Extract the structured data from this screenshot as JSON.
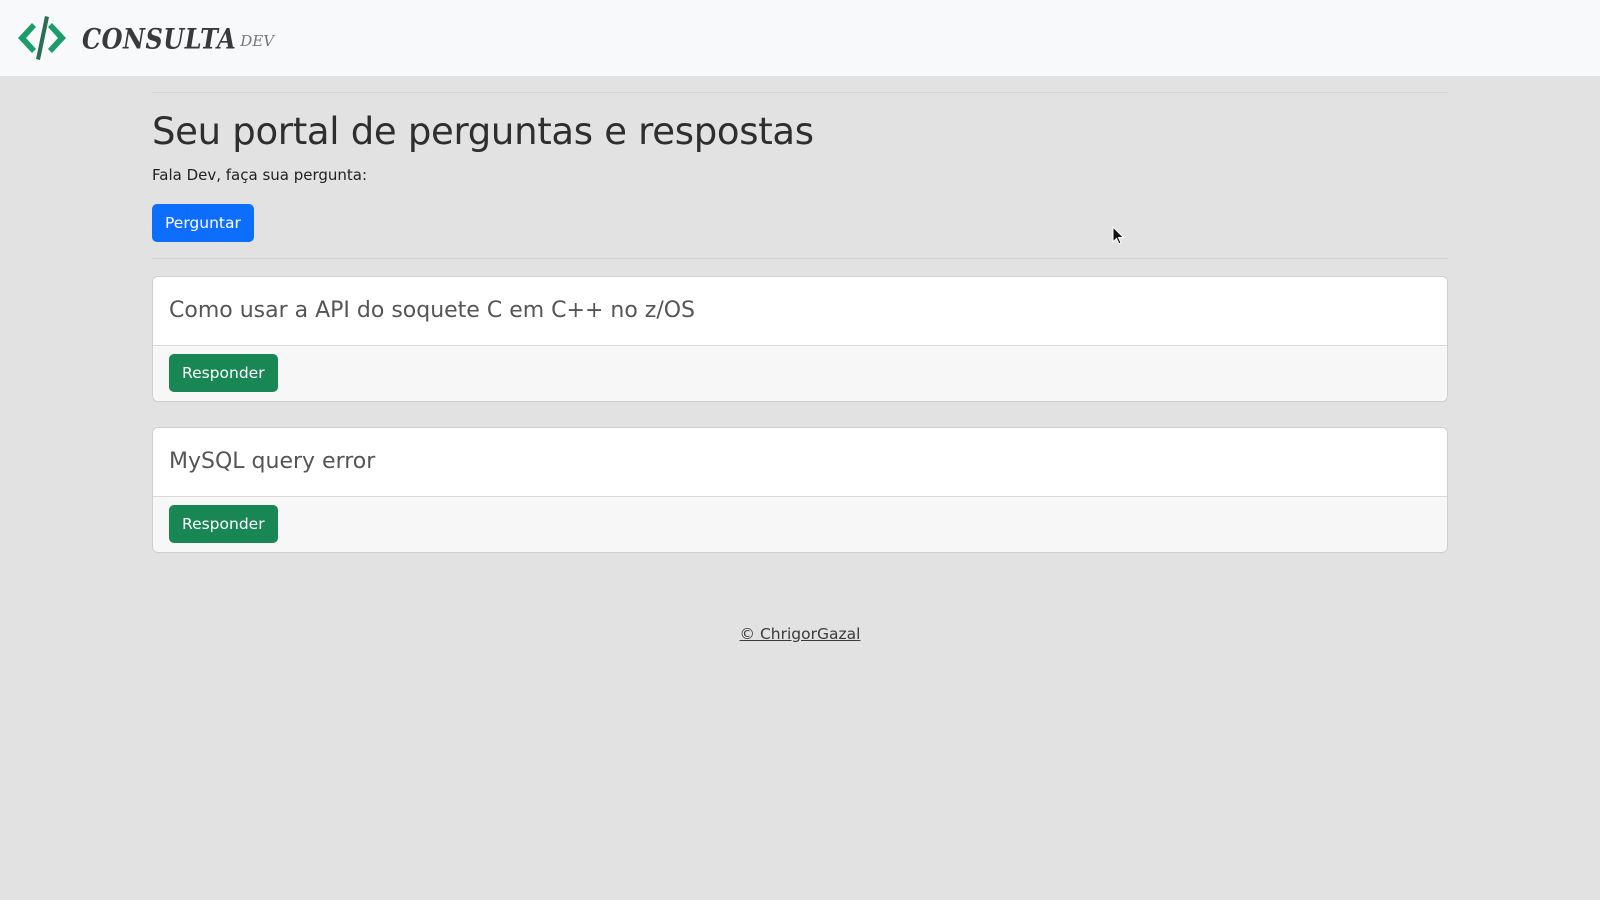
{
  "navbar": {
    "brand_word": "CONSULTA",
    "brand_sub": "DEV",
    "colors": {
      "logo_accent": "#1a9c6b",
      "logo_dark": "#2c6e54"
    },
    "icon": "code-brackets-icon"
  },
  "main": {
    "title": "Seu portal de perguntas e respostas",
    "subtitle": "Fala Dev, faça sua pergunta:",
    "ask_button": "Perguntar",
    "questions": [
      {
        "title": "Como usar a API do soquete C em C++ no z/OS",
        "answer_button": "Responder"
      },
      {
        "title": "MySQL query error",
        "answer_button": "Responder"
      }
    ]
  },
  "footer": {
    "credit": "© ChrigorGazal"
  },
  "colors": {
    "primary": "#0d6efd",
    "success": "#198754",
    "background": "#e2e2e2"
  }
}
